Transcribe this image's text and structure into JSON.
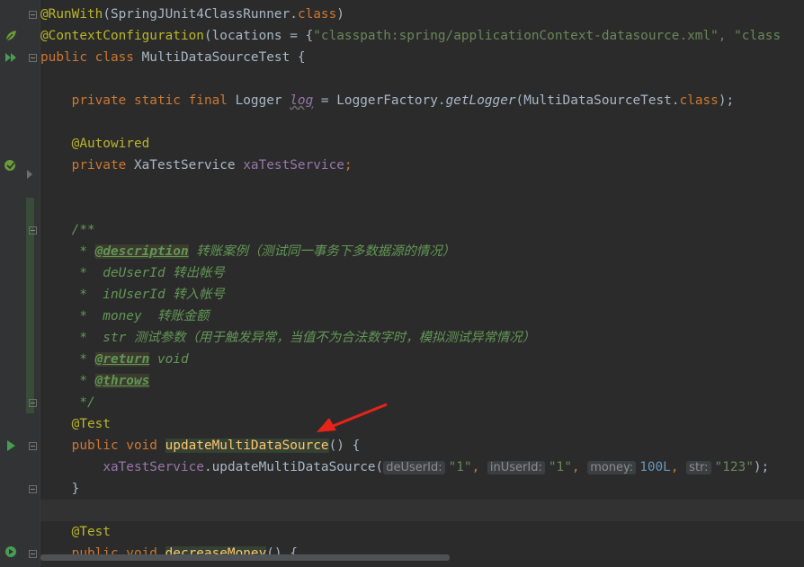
{
  "editor": {
    "lines": {
      "l1": {
        "annotation": "@RunWith",
        "paren_open": "(",
        "class_name": "SpringJUnit4ClassRunner",
        "dot": ".",
        "kw_class": "class",
        "paren_close": ")"
      },
      "l2": {
        "annotation": "@ContextConfiguration",
        "paren_open": "(",
        "param": "locations = ",
        "brace": "{",
        "string": "\"classpath:spring/applicationContext-datasource.xml\"",
        "rest": ", \"class"
      },
      "l3": {
        "kw_public": "public ",
        "kw_class": "class ",
        "name": "MultiDataSourceTest {"
      },
      "l5": {
        "kw": "private static final ",
        "type": "Logger ",
        "field": "log",
        "eq": " = LoggerFactory.",
        "method": "getLogger",
        "args": "(MultiDataSourceTest.",
        "kw_class": "class",
        "end": ");"
      },
      "l7": {
        "annotation": "@Autowired"
      },
      "l8": {
        "kw": "private ",
        "type": "XaTestService ",
        "field": "xaTestService",
        "end": ";"
      },
      "doc_open": "/**",
      "doc_star": " * ",
      "doc_desc_tag": "@description",
      "doc_desc_text": " 转账案例（测试同一事务下多数据源的情况）",
      "doc_p1": " *  deUserId 转出帐号",
      "doc_p2": " *  inUserId 转入帐号",
      "doc_p3": " *  money  转账金额",
      "doc_p4": " *  str 测试参数（用于触发异常，当值不为合法数字时，模拟测试异常情况）",
      "doc_return_tag": "@return",
      "doc_return_text": " void",
      "doc_throws_tag": "@throws",
      "doc_close": " */",
      "test1": "@Test",
      "m1_kw": "public void ",
      "m1_name": "updateMultiDataSource",
      "m1_rest": "() {",
      "call_obj": "xaTestService",
      "call_method": ".updateMultiDataSource(",
      "hint1": "deUserId:",
      "arg1": "\"1\"",
      "hint2": "inUserId:",
      "arg2": "\"1\"",
      "hint3": "money:",
      "arg3": "100L",
      "hint4": "str:",
      "arg4": "\"123\"",
      "call_end": ");",
      "comma": ", ",
      "close_brace": "}",
      "test2": "@Test",
      "m2_kw": "public void ",
      "m2_name": "decreaseMoney",
      "m2_rest": "() {"
    }
  },
  "colors": {
    "background": "#2b2b2b",
    "arrow": "#e8231a",
    "keyword": "#cc7832",
    "annotation": "#bbb529"
  },
  "icons": [
    "fold-icon",
    "spring-bean-icon",
    "run-class-icon",
    "autowired-bean-icon",
    "run-test-icon",
    "run-test-debug-icon",
    "red-arrow-icon"
  ]
}
